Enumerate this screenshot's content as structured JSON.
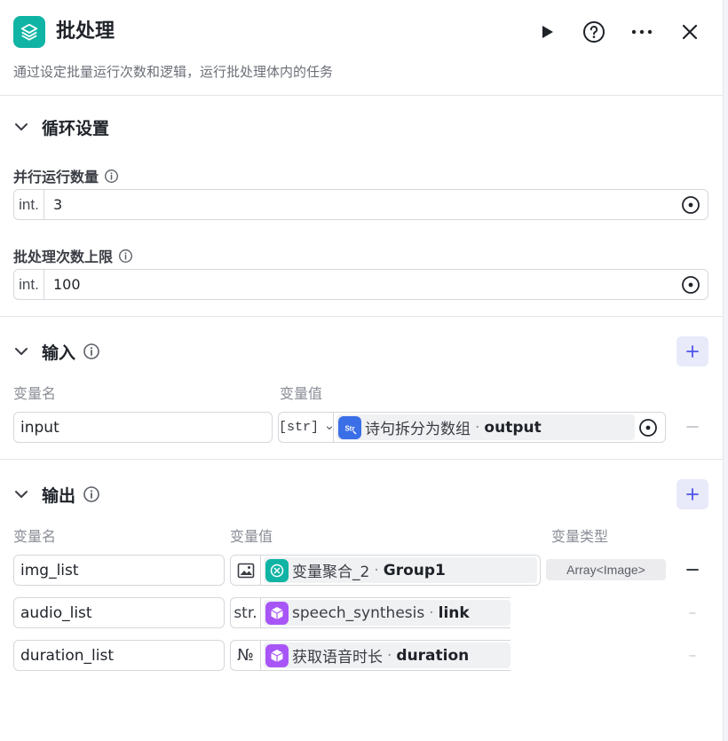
{
  "header": {
    "title": "批处理",
    "description": "通过设定批量运行次数和逻辑，运行批处理体内的任务"
  },
  "loop_settings": {
    "title": "循环设置",
    "parallel": {
      "label": "并行运行数量",
      "prefix": "int.",
      "value": "3"
    },
    "batch_limit": {
      "label": "批处理次数上限",
      "prefix": "int.",
      "value": "100"
    }
  },
  "inputs": {
    "title": "输入",
    "col_name": "变量名",
    "col_value": "变量值",
    "rows": [
      {
        "name": "input",
        "type": "[str]",
        "node": "诗句拆分为数组",
        "field": "output"
      }
    ]
  },
  "outputs": {
    "title": "输出",
    "col_name": "变量名",
    "col_value": "变量值",
    "col_type": "变量类型",
    "rows": [
      {
        "name": "img_list",
        "type_icon": "image-icon",
        "node": "变量聚合_2",
        "field": "Group1",
        "var_type": "Array<Image>"
      },
      {
        "name": "audio_list",
        "type": "str.",
        "node": "speech_synthesis",
        "field": "link"
      },
      {
        "name": "duration_list",
        "type": "№",
        "node": "获取语音时长",
        "field": "duration"
      }
    ]
  },
  "colors": {
    "brand": "#10b4a4",
    "accent": "#4d53e8",
    "plugin": "#a855f7",
    "str_node": "#3b6fe8"
  }
}
